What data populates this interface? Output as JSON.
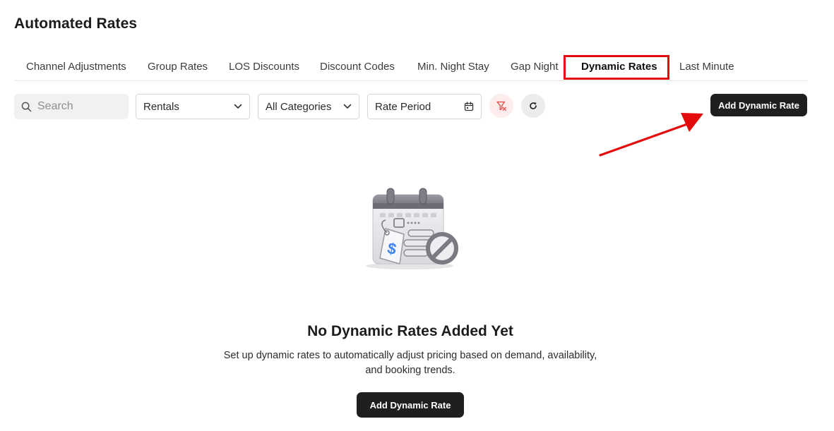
{
  "page": {
    "title": "Automated Rates"
  },
  "tabs": [
    {
      "label": "Channel Adjustments",
      "active": false
    },
    {
      "label": "Group Rates",
      "active": false
    },
    {
      "label": "LOS Discounts",
      "active": false
    },
    {
      "label": "Discount Codes",
      "active": false
    },
    {
      "label": "Min. Night Stay",
      "active": false
    },
    {
      "label": "Gap Night",
      "active": false
    },
    {
      "label": "Dynamic Rates",
      "active": true
    },
    {
      "label": "Last Minute",
      "active": false
    }
  ],
  "toolbar": {
    "search_placeholder": "Search",
    "search_icon": "search-icon",
    "rentals_select": "Rentals",
    "categories_select": "All Categories",
    "rate_period": "Rate Period",
    "calendar_icon": "calendar-icon",
    "clear_filter_icon": "filter-clear-icon",
    "refresh_icon": "refresh-icon",
    "add_button": "Add Dynamic Rate"
  },
  "empty_state": {
    "illustration": "calendar-price-tag-illustration",
    "title": "No Dynamic Rates Added Yet",
    "description_line1": "Set up dynamic rates to automatically adjust pricing based on demand, availability,",
    "description_line2": "and booking trends.",
    "button": "Add Dynamic Rate"
  },
  "annotation": {
    "highlight_color": "#e30b0b",
    "arrow_color": "#e30b0b"
  },
  "colors": {
    "primary_button": "#1f1f1f",
    "filter_clear_bg": "#fdecec",
    "filter_clear_icon": "#e04848"
  }
}
